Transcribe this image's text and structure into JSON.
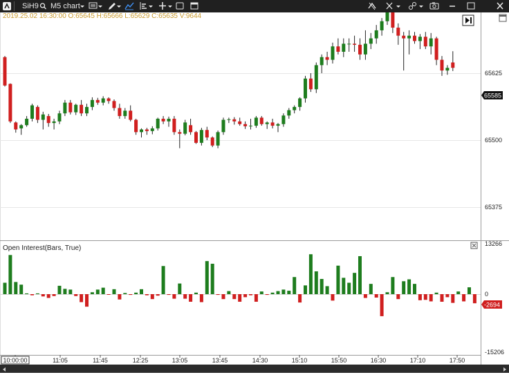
{
  "toolbar": {
    "logo_icon": "atas-logo-icon",
    "symbol": "SiH9",
    "timeframe": "M5 chart",
    "icons": [
      "search-icon",
      "chart-type-icon",
      "pencil-icon",
      "indicator-icon",
      "layout-icon",
      "crosshair-icon",
      "window-icon",
      "magnet-icon",
      "cross-cursor-icon",
      "link-icon",
      "camera-icon",
      "minimize-icon",
      "maximize-icon",
      "close-icon"
    ]
  },
  "quote": "2019.25.02 16:30:00 O:65645 H:65666 L:65629 C:65635 V:9644",
  "price_axis": {
    "ticks": [
      "65625",
      "65500",
      "65375"
    ],
    "current_price": "65585"
  },
  "indicator": {
    "title": "Open Interest(Bars, True)",
    "ticks": [
      "13266",
      "0",
      "-15206"
    ],
    "current_value": "-2694"
  },
  "time_axis": {
    "labels": [
      "10:00:00",
      "11:05",
      "11:45",
      "12:25",
      "13:05",
      "13:45",
      "14:30",
      "15:10",
      "15:50",
      "16:30",
      "17:10",
      "17:50"
    ]
  },
  "colors": {
    "up": "#1e7d1e",
    "down": "#d01f1f",
    "toolbar_bg": "#202020",
    "quote_text": "#c99a2e"
  },
  "chart_data": [
    {
      "type": "candlestick",
      "ylim": [
        65330,
        65770
      ],
      "candles": [
        [
          65655,
          65657,
          65600,
          65602
        ],
        [
          65605,
          65606,
          65532,
          65535
        ],
        [
          65533,
          65535,
          65514,
          65520
        ],
        [
          65522,
          65530,
          65510,
          65528
        ],
        [
          65528,
          65545,
          65525,
          65540
        ],
        [
          65540,
          65568,
          65535,
          65565
        ],
        [
          65562,
          65565,
          65532,
          65538
        ],
        [
          65538,
          65553,
          65520,
          65548
        ],
        [
          65545,
          65549,
          65525,
          65532
        ],
        [
          65532,
          65540,
          65520,
          65535
        ],
        [
          65535,
          65555,
          65530,
          65550
        ],
        [
          65550,
          65575,
          65545,
          65570
        ],
        [
          65570,
          65575,
          65548,
          65552
        ],
        [
          65552,
          65568,
          65547,
          65566
        ],
        [
          65566,
          65575,
          65545,
          65550
        ],
        [
          65550,
          65568,
          65545,
          65562
        ],
        [
          65562,
          65580,
          65556,
          65575
        ],
        [
          65575,
          65579,
          65566,
          65570
        ],
        [
          65570,
          65582,
          65565,
          65578
        ],
        [
          65578,
          65580,
          65568,
          65573
        ],
        [
          65573,
          65576,
          65555,
          65560
        ],
        [
          65560,
          65568,
          65540,
          65545
        ],
        [
          65545,
          65560,
          65540,
          65555
        ],
        [
          65555,
          65565,
          65535,
          65538
        ],
        [
          65538,
          65540,
          65510,
          65515
        ],
        [
          65515,
          65522,
          65505,
          65520
        ],
        [
          65520,
          65523,
          65510,
          65517
        ],
        [
          65517,
          65526,
          65511,
          65522
        ],
        [
          65522,
          65542,
          65518,
          65540
        ],
        [
          65540,
          65545,
          65530,
          65535
        ],
        [
          65535,
          65544,
          65525,
          65540
        ],
        [
          65540,
          65545,
          65510,
          65515
        ],
        [
          65515,
          65520,
          65485,
          65512
        ],
        [
          65512,
          65538,
          65509,
          65533
        ],
        [
          65528,
          65540,
          65510,
          65515
        ],
        [
          65515,
          65517,
          65493,
          65495
        ],
        [
          65495,
          65523,
          65490,
          65519
        ],
        [
          65519,
          65525,
          65500,
          65505
        ],
        [
          65505,
          65507,
          65487,
          65490
        ],
        [
          65490,
          65518,
          65485,
          65515
        ],
        [
          65515,
          65542,
          65510,
          65538
        ],
        [
          65538,
          65542,
          65532,
          65539
        ],
        [
          65539,
          65543,
          65529,
          65535
        ],
        [
          65535,
          65542,
          65527,
          65530
        ],
        [
          65530,
          65535,
          65521,
          65526
        ],
        [
          65526,
          65540,
          65520,
          65527
        ],
        [
          65527,
          65545,
          65523,
          65542
        ],
        [
          65542,
          65545,
          65527,
          65530
        ],
        [
          65530,
          65535,
          65521,
          65533
        ],
        [
          65533,
          65540,
          65522,
          65527
        ],
        [
          65527,
          65532,
          65515,
          65530
        ],
        [
          65530,
          65550,
          65525,
          65546
        ],
        [
          65546,
          65560,
          65540,
          65556
        ],
        [
          65556,
          65565,
          65550,
          65562
        ],
        [
          65562,
          65580,
          65555,
          65578
        ],
        [
          65578,
          65620,
          65570,
          65615
        ],
        [
          65615,
          65625,
          65590,
          65595
        ],
        [
          65595,
          65645,
          65588,
          65640
        ],
        [
          65640,
          65660,
          65625,
          65655
        ],
        [
          65655,
          65665,
          65640,
          65650
        ],
        [
          65650,
          65682,
          65643,
          65675
        ],
        [
          65675,
          65690,
          65660,
          65665
        ],
        [
          65665,
          65690,
          65655,
          65680
        ],
        [
          65680,
          65690,
          65665,
          65680
        ],
        [
          65680,
          65695,
          65665,
          65678
        ],
        [
          65678,
          65690,
          65650,
          65660
        ],
        [
          65660,
          65705,
          65650,
          65680
        ],
        [
          65680,
          65700,
          65670,
          65690
        ],
        [
          65690,
          65715,
          65680,
          65705
        ],
        [
          65705,
          65728,
          65695,
          65722
        ],
        [
          65722,
          65745,
          65715,
          65740
        ],
        [
          65740,
          65748,
          65700,
          65710
        ],
        [
          65710,
          65718,
          65678,
          65695
        ],
        [
          65695,
          65702,
          65630,
          65690
        ],
        [
          65690,
          65705,
          65660,
          65695
        ],
        [
          65695,
          65702,
          65680,
          65685
        ],
        [
          65685,
          65698,
          65670,
          65693
        ],
        [
          65693,
          65702,
          65670,
          65675
        ],
        [
          65675,
          65700,
          65660,
          65690
        ],
        [
          65690,
          65693,
          65640,
          65650
        ],
        [
          65650,
          65657,
          65620,
          65630
        ],
        [
          65630,
          65640,
          65622,
          65635
        ],
        [
          65645,
          65666,
          65629,
          65635
        ]
      ]
    },
    {
      "type": "bar",
      "title": "Open Interest(Bars, True)",
      "ylim": [
        -15206,
        13266
      ],
      "values": [
        3000,
        10300,
        3200,
        2500,
        200,
        -300,
        200,
        -600,
        -1000,
        -500,
        2200,
        1400,
        1200,
        -500,
        -2100,
        -3300,
        500,
        1200,
        1700,
        -100,
        1300,
        -1400,
        300,
        -200,
        400,
        1300,
        -300,
        -1300,
        -400,
        7400,
        -200,
        -1200,
        2800,
        -1200,
        -2000,
        400,
        -2100,
        8700,
        8000,
        -200,
        -1300,
        800,
        -1300,
        -2000,
        -800,
        -300,
        -2000,
        700,
        -200,
        400,
        800,
        1200,
        900,
        4500,
        -2200,
        2300,
        10500,
        6000,
        4000,
        2100,
        -1700,
        7500,
        4300,
        3000,
        5600,
        10000,
        -1000,
        2700,
        -900,
        -5800,
        500,
        4500,
        -1300,
        3400,
        3900,
        2700,
        -1600,
        -1500,
        -1900,
        400,
        -2000,
        -800,
        -2300,
        700,
        -1900,
        1800,
        -2400
      ]
    }
  ]
}
